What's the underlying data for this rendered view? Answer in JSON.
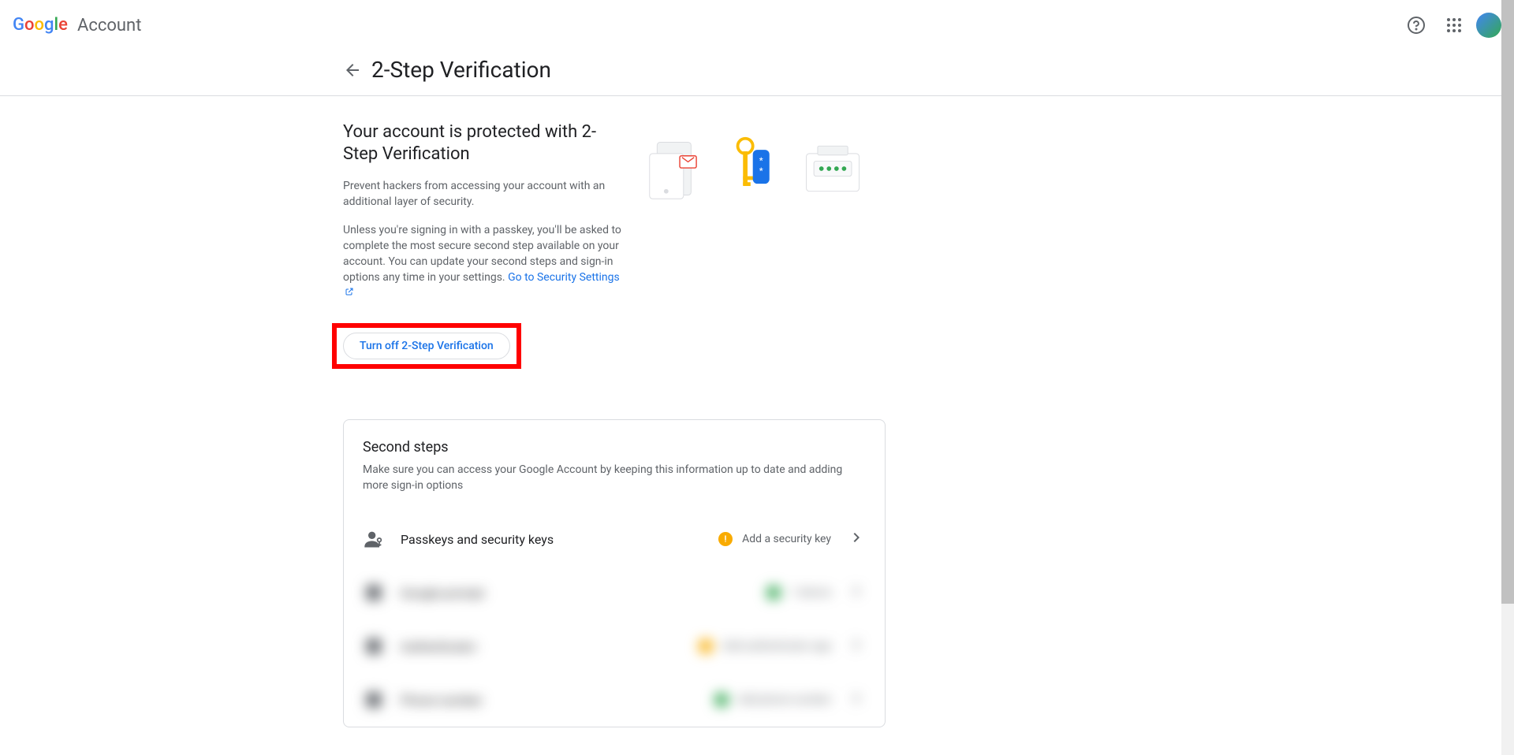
{
  "header": {
    "logo_text": "Google",
    "account_text": "Account"
  },
  "page": {
    "title": "2-Step Verification"
  },
  "intro": {
    "title": "Your account is protected with 2-Step Verification",
    "desc1": "Prevent hackers from accessing your account with an additional layer of security.",
    "desc2": "Unless you're signing in with a passkey, you'll be asked to complete the most secure second step available on your account. You can update your second steps and sign-in options any time in your settings. ",
    "link_text": "Go to Security Settings"
  },
  "button": {
    "turn_off": "Turn off 2-Step Verification"
  },
  "card": {
    "title": "Second steps",
    "desc": "Make sure you can access your Google Account by keeping this information up to date and adding more sign-in options"
  },
  "steps": [
    {
      "label": "Passkeys and security keys",
      "status_text": "Add a security key",
      "status_type": "warning"
    },
    {
      "label": "Google prompt",
      "status_text": "1 device",
      "status_type": "success"
    },
    {
      "label": "Authenticator",
      "status_text": "Add authenticator app",
      "status_type": "warning"
    },
    {
      "label": "Phone number",
      "status_text": "Add phone number",
      "status_type": "success"
    }
  ]
}
